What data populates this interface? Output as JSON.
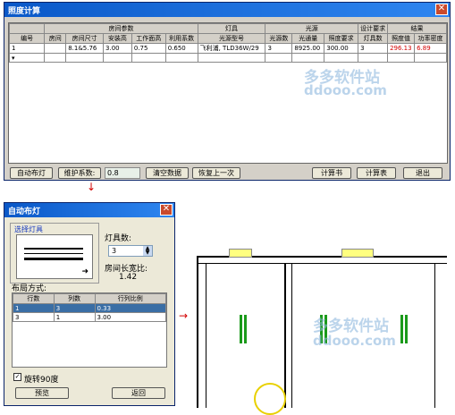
{
  "main_window": {
    "title": "照度计算",
    "group_headers": [
      "房间参数",
      "灯具",
      "光源",
      "设计要求",
      "结果"
    ],
    "columns": [
      "编号",
      "房间",
      "房间尺寸",
      "安装高",
      "工作面高",
      "利用系数",
      "光源型号",
      "光源数",
      "光通量",
      "照度要求",
      "灯具数",
      "照度值",
      "功率密度"
    ],
    "row": [
      "1",
      "",
      "8.1&5.76",
      "3.00",
      "0.75",
      "0.650",
      "飞利浦, TLD36W/29",
      "3",
      "8925.00",
      "300.00",
      "3",
      "296.13",
      "6.89"
    ],
    "buttons": {
      "auto_layout": "自动布灯",
      "maintenance_label": "维护系数:",
      "maintenance_value": "0.8",
      "clear": "清空数据",
      "restore": "恢复上一次",
      "calc_book": "计算书",
      "calc_table": "计算表",
      "exit": "退出"
    }
  },
  "dialog": {
    "title": "自动布灯",
    "select_lamp": "选择灯具",
    "lamp_count_label": "灯具数:",
    "lamp_count_value": "3",
    "ratio_label": "房间长宽比:",
    "ratio_value": "1.42",
    "layout_label": "布局方式:",
    "layout_columns": [
      "行数",
      "列数",
      "行列比例"
    ],
    "layout_rows": [
      [
        "1",
        "3",
        "0.33"
      ],
      [
        "3",
        "1",
        "3.00"
      ]
    ],
    "rotate_label": "旋转90度",
    "preview": "预览",
    "back": "返回"
  },
  "watermark": {
    "brand": "多多软件站",
    "url": "ddooo.com"
  },
  "colors": {
    "titlebar": "#0a58c8",
    "selected_row": "#3a6ea5",
    "lamp_green": "#1a9a1a",
    "red_value": "#d40000"
  }
}
